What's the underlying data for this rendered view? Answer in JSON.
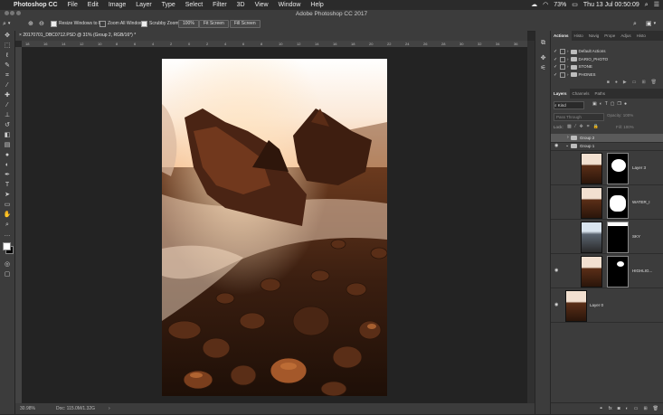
{
  "menubar": {
    "app": "Photoshop CC",
    "items": [
      "File",
      "Edit",
      "Image",
      "Layer",
      "Type",
      "Select",
      "Filter",
      "3D",
      "View",
      "Window",
      "Help"
    ],
    "battery": "73%",
    "datetime": "Thu 13 Jul  00:50:09"
  },
  "window_title": "Adobe Photoshop CC 2017",
  "options": {
    "resize_windows": "Resize Windows to Fit",
    "zoom_all": "Zoom All Windows",
    "scrubby_zoom": "Scrubby Zoom",
    "zoom_100": "100%",
    "fit_screen": "Fit Screen",
    "fill_screen": "Fill Screen"
  },
  "document": {
    "tab": "20170701_DBC0712.PSD @ 31% (Group 2, RGB/16*) *",
    "ruler_ticks": [
      "18",
      "16",
      "14",
      "12",
      "10",
      "8",
      "6",
      "4",
      "2",
      "0",
      "2",
      "4",
      "6",
      "8",
      "10",
      "12",
      "14",
      "16",
      "18",
      "20",
      "22",
      "24",
      "26",
      "28",
      "30",
      "32",
      "34",
      "36"
    ]
  },
  "status": {
    "zoom": "30.98%",
    "doc": "Doc: 115.0M/1.32G"
  },
  "actions_panel": {
    "tabs": [
      "Actions",
      "Histo",
      "Navig",
      "Prope",
      "Adjus",
      "Histo"
    ],
    "rows": [
      "Default Actions",
      "DARIO_PHOTO",
      "STONE",
      "PHONES"
    ]
  },
  "layers_panel": {
    "tabs": [
      "Layers",
      "Channels",
      "Paths"
    ],
    "filter_kind": "Kind",
    "blend_mode": "Pass Through",
    "opacity_label": "Opacity:",
    "opacity_value": "100%",
    "lock_label": "Lock:",
    "fill_label": "Fill:",
    "fill_value": "100%",
    "layers": [
      {
        "name": "Group 2",
        "type": "group"
      },
      {
        "name": "Group 1",
        "type": "group"
      },
      {
        "name": "Layer 3",
        "type": "masked"
      },
      {
        "name": "WATER_I",
        "type": "masked"
      },
      {
        "name": "SKY",
        "type": "masked"
      },
      {
        "name": "HIGHLIG...",
        "type": "masked"
      },
      {
        "name": "Layer 0",
        "type": "pixel"
      }
    ],
    "footer_fx": "fx"
  }
}
